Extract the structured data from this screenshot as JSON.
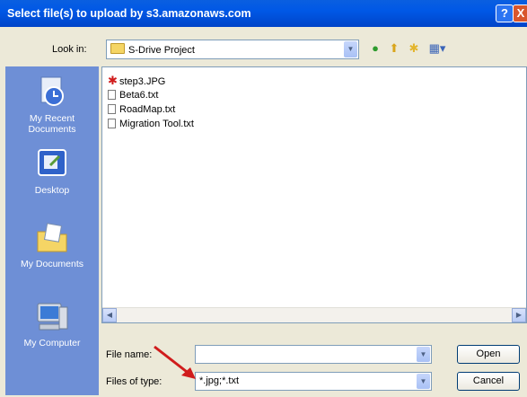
{
  "window": {
    "title": "Select file(s) to upload by s3.amazonaws.com",
    "help_label": "?",
    "close_label": "X"
  },
  "look_in": {
    "label": "Look in:",
    "value": "S-Drive Project"
  },
  "places": [
    {
      "label": "My Recent Documents",
      "icon": "my-recent-documents-icon"
    },
    {
      "label": "Desktop",
      "icon": "desktop-icon"
    },
    {
      "label": "My Documents",
      "icon": "my-documents-icon"
    },
    {
      "label": "My Computer",
      "icon": "my-computer-icon"
    }
  ],
  "files": [
    {
      "name": "step3.JPG",
      "type": "image"
    },
    {
      "name": "Beta6.txt",
      "type": "text"
    },
    {
      "name": "RoadMap.txt",
      "type": "text"
    },
    {
      "name": "Migration Tool.txt",
      "type": "text"
    }
  ],
  "file_name": {
    "label": "File name:",
    "value": ""
  },
  "files_of_type": {
    "label": "Files of type:",
    "value": "*.jpg;*.txt"
  },
  "buttons": {
    "open": "Open",
    "cancel": "Cancel"
  },
  "colors": {
    "title_bar": "#0058e6",
    "places_bar": "#6e8fd6",
    "annotation_arrow": "#d01c1c"
  }
}
